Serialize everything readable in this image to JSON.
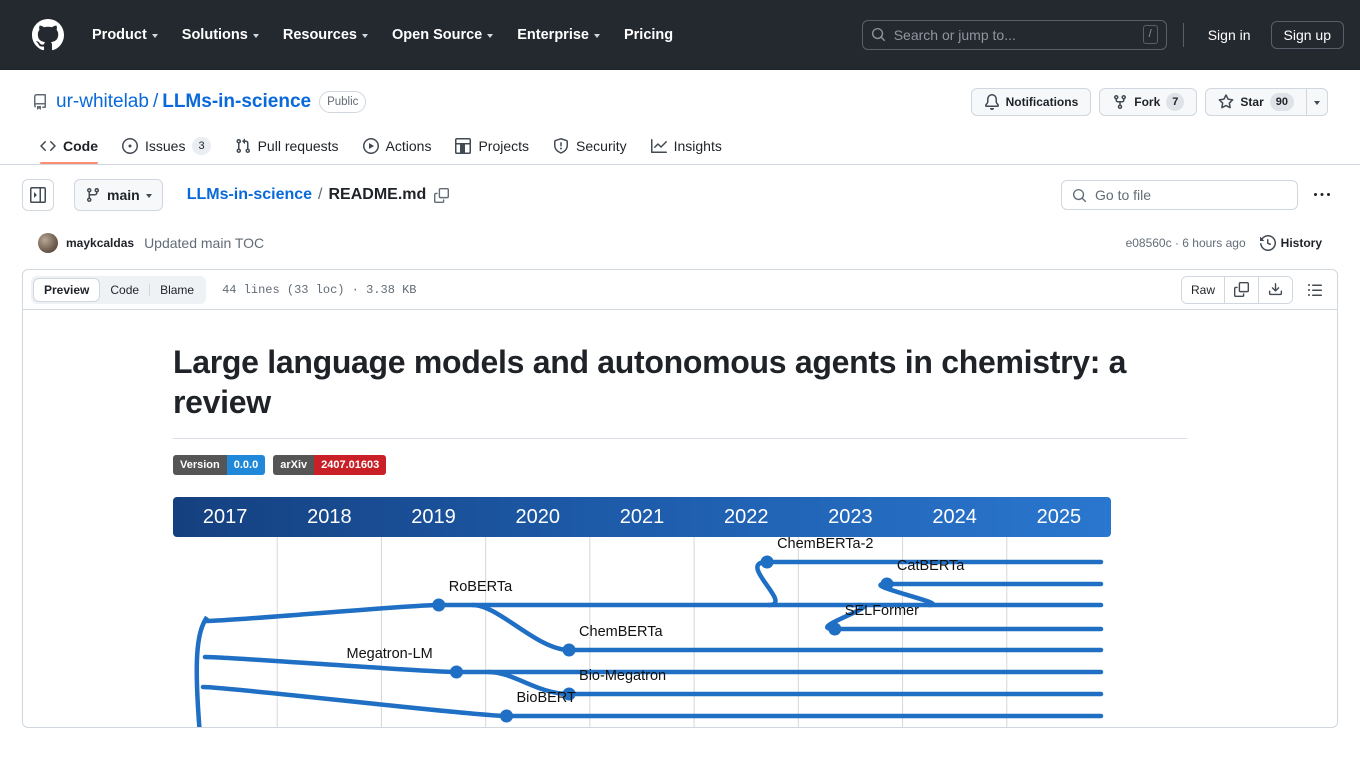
{
  "header": {
    "logo_icon": "github-mark-icon",
    "nav": [
      {
        "label": "Product",
        "has_caret": true
      },
      {
        "label": "Solutions",
        "has_caret": true
      },
      {
        "label": "Resources",
        "has_caret": true
      },
      {
        "label": "Open Source",
        "has_caret": true
      },
      {
        "label": "Enterprise",
        "has_caret": true
      },
      {
        "label": "Pricing",
        "has_caret": false
      }
    ],
    "search_placeholder": "Search or jump to...",
    "search_shortcut": "/",
    "sign_in": "Sign in",
    "sign_up": "Sign up"
  },
  "repo": {
    "owner": "ur-whitelab",
    "separator": "/",
    "name": "LLMs-in-science",
    "visibility": "Public",
    "notifications_label": "Notifications",
    "fork_label": "Fork",
    "fork_count": "7",
    "star_label": "Star",
    "star_count": "90"
  },
  "tabs": [
    {
      "label": "Code",
      "icon": "code-icon",
      "count": null,
      "active": true
    },
    {
      "label": "Issues",
      "icon": "issue-opened-icon",
      "count": "3",
      "active": false
    },
    {
      "label": "Pull requests",
      "icon": "git-pull-request-icon",
      "count": null,
      "active": false
    },
    {
      "label": "Actions",
      "icon": "play-icon",
      "count": null,
      "active": false
    },
    {
      "label": "Projects",
      "icon": "table-icon",
      "count": null,
      "active": false
    },
    {
      "label": "Security",
      "icon": "shield-icon",
      "count": null,
      "active": false
    },
    {
      "label": "Insights",
      "icon": "graph-icon",
      "count": null,
      "active": false
    }
  ],
  "file_nav": {
    "sidebar_toggle_icon": "sidebar-expand-icon",
    "branch": "main",
    "breadcrumb_repo": "LLMs-in-science",
    "breadcrumb_sep": "/",
    "breadcrumb_file": "README.md",
    "copy_path_icon": "copy-icon",
    "go_to_file_placeholder": "Go to file",
    "more_options_icon": "kebab-horizontal-icon"
  },
  "commit": {
    "author": "maykcaldas",
    "message": "Updated main TOC",
    "sha_and_time": "e08560c · 6 hours ago",
    "history_label": "History",
    "history_icon": "history-icon"
  },
  "file_toolbar": {
    "views": [
      {
        "label": "Preview",
        "active": true
      },
      {
        "label": "Code",
        "active": false
      },
      {
        "label": "Blame",
        "active": false
      }
    ],
    "meta": "44 lines (33 loc) · 3.38 KB",
    "raw_label": "Raw",
    "copy_icon": "copy-icon",
    "download_icon": "download-icon",
    "outline_icon": "list-unordered-icon"
  },
  "readme": {
    "title": "Large language models and autonomous agents in chemistry: a review",
    "badges": [
      {
        "label": "Version",
        "value": "0.0.0",
        "color": "#2088d8"
      },
      {
        "label": "arXiv",
        "value": "2407.01603",
        "color": "#c91f26"
      }
    ]
  },
  "chart_data": {
    "type": "timeline",
    "title": "Timeline of chemistry language models",
    "categories": [
      "2017",
      "2018",
      "2019",
      "2020",
      "2021",
      "2022",
      "2023",
      "2024",
      "2025"
    ],
    "axis_bar_colors": [
      "#15407f",
      "#2a77cf"
    ],
    "node_color": "#1f6fc4",
    "nodes": [
      {
        "label": "RoBERTa",
        "year": 2019.55,
        "lane": 3
      },
      {
        "label": "ChemBERTa-2",
        "year": 2022.7,
        "lane": 1
      },
      {
        "label": "CatBERTa",
        "year": 2023.85,
        "lane": 2
      },
      {
        "label": "SELFormer",
        "year": 2023.35,
        "lane": 4
      },
      {
        "label": "ChemBERTa",
        "year": 2020.8,
        "lane": 5
      },
      {
        "label": "Megatron-LM",
        "year": 2019.72,
        "lane": 6
      },
      {
        "label": "Bio-Megatron",
        "year": 2020.8,
        "lane": 7
      },
      {
        "label": "BioBERT",
        "year": 2020.2,
        "lane": 8
      }
    ]
  }
}
